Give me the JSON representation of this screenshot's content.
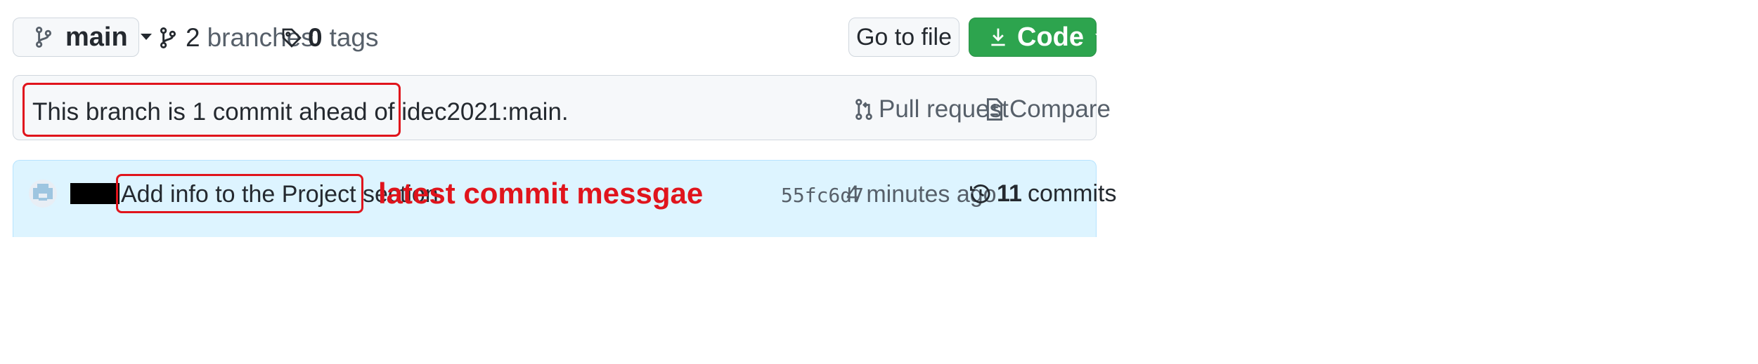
{
  "branch_select": {
    "label": "main"
  },
  "branches": {
    "count": "2",
    "label": "branches"
  },
  "tags": {
    "count": "0",
    "label": "tags"
  },
  "go_to_file": {
    "label": "Go to file"
  },
  "code_button": {
    "label": "Code"
  },
  "branch_status": {
    "prefix": "This branch is ",
    "count": "1",
    "suffix": " commit ahead of idec2021:main."
  },
  "pull_request": {
    "label": "Pull request"
  },
  "compare": {
    "label": "Compare"
  },
  "latest_commit": {
    "message": "Add info to the Project section",
    "sha": "55fc6d7",
    "time": "4 minutes ago",
    "commits_count": "11",
    "commits_label": "commits"
  },
  "annotation": {
    "text": "latest commit messgae"
  },
  "colors": {
    "primary_green": "#2da44e",
    "annotation_red": "#e0141c",
    "commit_bar_bg": "#ddf4ff",
    "status_bar_bg": "#f6f8fa"
  },
  "icons": [
    "git-branch-icon",
    "triangle-down-icon",
    "tag-icon",
    "download-icon",
    "git-pull-request-icon",
    "diff-icon",
    "history-icon",
    "avatar"
  ]
}
